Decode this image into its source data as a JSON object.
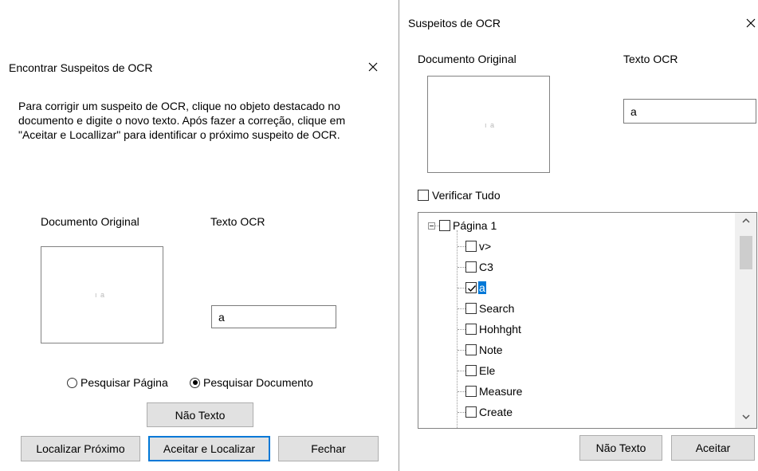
{
  "left_dialog": {
    "title": "Encontrar Suspeitos de OCR",
    "instructions": "Para corrigir um suspeito de OCR, clique no objeto destacado no documento e digite o novo texto. Após fazer a correção, clique em \"Aceitar e Locallizar\" para identificar o próximo suspeito de OCR.",
    "original_label": "Documento Original",
    "ocr_label": "Texto OCR",
    "preview_glyph": "ı a",
    "ocr_value": "a",
    "radio_page": "Pesquisar Página",
    "radio_document": "Pesquisar Documento",
    "radio_selected": "document",
    "not_text_button": "Não Texto",
    "find_next_button": "Localizar Próximo",
    "accept_find_button": "Aceitar e Localizar",
    "close_button": "Fechar"
  },
  "right_dialog": {
    "title": "Suspeitos de OCR",
    "original_label": "Documento Original",
    "ocr_label": "Texto OCR",
    "preview_glyph": "ı a",
    "ocr_value": "a",
    "verify_all_label": "Verificar Tudo",
    "tree": {
      "root": "Página 1",
      "items": [
        {
          "label": "v>",
          "checked": false
        },
        {
          "label": "C3",
          "checked": false
        },
        {
          "label": "a",
          "checked": true,
          "selected": true
        },
        {
          "label": "Search",
          "checked": false
        },
        {
          "label": "Hohhght",
          "checked": false
        },
        {
          "label": "Note",
          "checked": false
        },
        {
          "label": "Ele",
          "checked": false
        },
        {
          "label": "Measure",
          "checked": false
        },
        {
          "label": "Create",
          "checked": false
        }
      ]
    },
    "not_text_button": "Não Texto",
    "accept_button": "Aceitar"
  },
  "icons": {
    "close": "close-icon",
    "scroll_up": "scroll-up-icon",
    "scroll_down": "scroll-down-icon",
    "collapse": "tree-collapse-icon",
    "checkmark": "checkmark-icon"
  },
  "colors": {
    "accent": "#0078d7",
    "button_face": "#e1e1e1",
    "button_border": "#adadad"
  }
}
